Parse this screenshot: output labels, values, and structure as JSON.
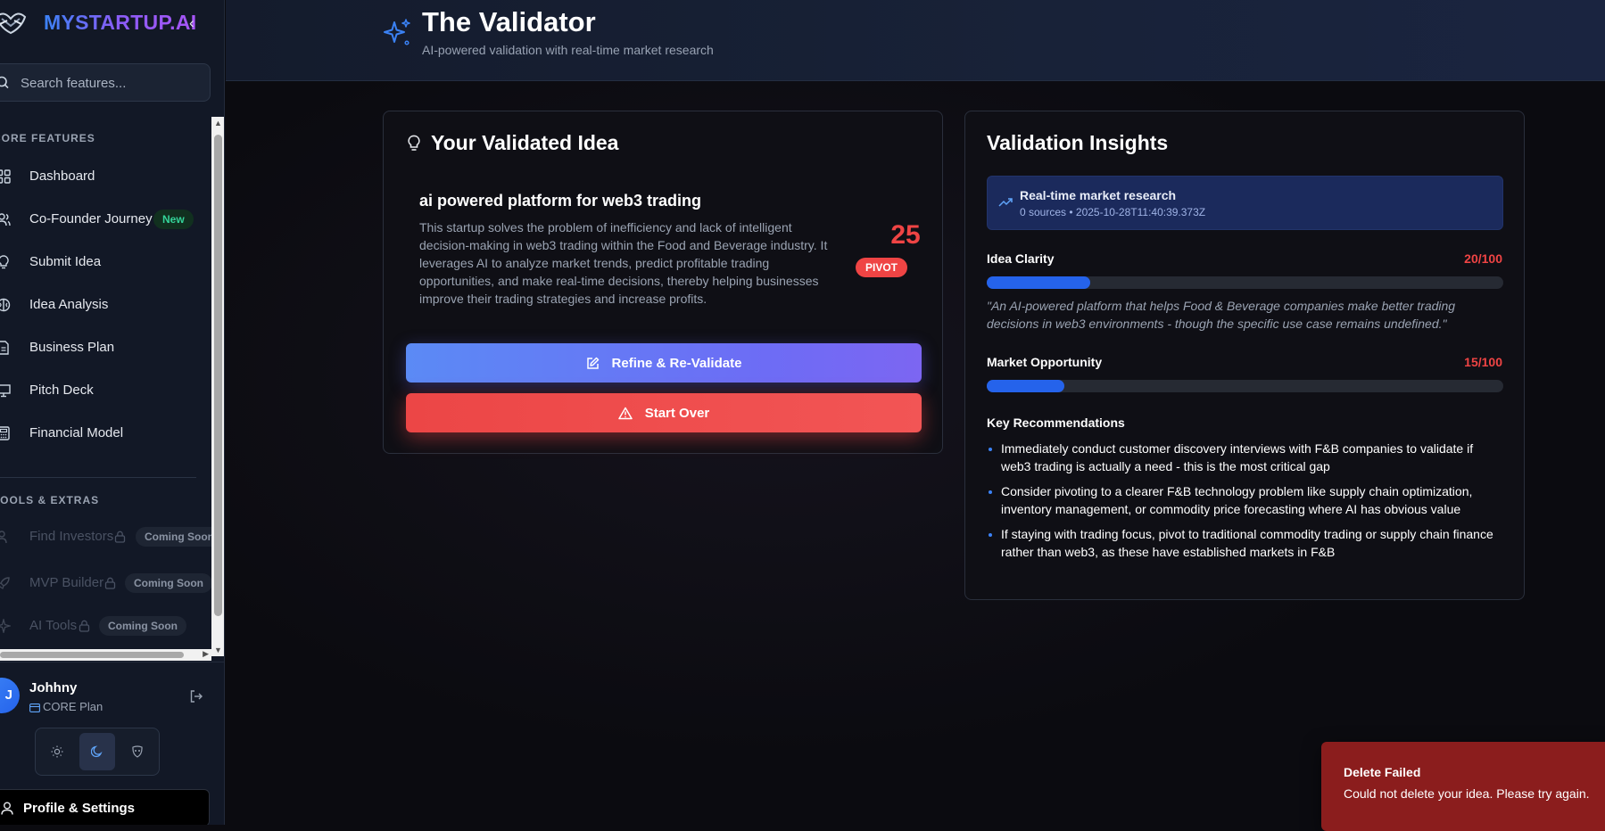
{
  "brand": {
    "name": "MYSTARTUP.AI",
    "collapse_glyph": "‹"
  },
  "search": {
    "placeholder": "Search features..."
  },
  "sidebar": {
    "sections": [
      {
        "label": "CORE FEATURES",
        "items": [
          {
            "label": "Dashboard",
            "icon": "grid-icon"
          },
          {
            "label": "Co-Founder Journey",
            "icon": "users-icon",
            "badge": "New"
          },
          {
            "label": "Submit Idea",
            "icon": "lightbulb-icon"
          },
          {
            "label": "Idea Analysis",
            "icon": "brain-icon"
          },
          {
            "label": "Business Plan",
            "icon": "document-icon"
          },
          {
            "label": "Pitch Deck",
            "icon": "presentation-icon"
          },
          {
            "label": "Financial Model",
            "icon": "calculator-icon"
          }
        ]
      },
      {
        "label": "TOOLS & EXTRAS",
        "items": [
          {
            "label": "Find Investors",
            "icon": "users-icon",
            "badge": "Coming Soon",
            "locked": true
          },
          {
            "label": "MVP Builder",
            "icon": "rocket-icon",
            "badge": "Coming Soon",
            "locked": true
          },
          {
            "label": "AI Tools",
            "icon": "sparkle-icon",
            "badge": "Coming Soon",
            "locked": true
          }
        ]
      }
    ]
  },
  "user": {
    "initial": "J",
    "name": "Johhny",
    "plan": "CORE Plan",
    "theme_options": [
      "light",
      "dark",
      "system"
    ],
    "theme_selected": "dark"
  },
  "profile_button": {
    "label": "Profile & Settings"
  },
  "header": {
    "title": "The Validator",
    "subtitle": "AI-powered validation with real-time market research"
  },
  "idea_card": {
    "title": "Your Validated Idea",
    "idea_name": "ai powered platform for web3 trading",
    "description": "This startup solves the problem of inefficiency and lack of intelligent decision-making in web3 trading within the Food and Beverage industry. It leverages AI to analyze market trends, predict profitable trading opportunities, and make real-time decisions, thereby helping businesses improve their trading strategies and increase profits.",
    "score": "25",
    "verdict": "PIVOT",
    "refine_label": "Refine & Re-Validate",
    "start_over_label": "Start Over"
  },
  "insights": {
    "title": "Validation Insights",
    "research": {
      "title": "Real-time market research",
      "meta": "0 sources • 2025-10-28T11:40:39.373Z"
    },
    "metrics": [
      {
        "label": "Idea Clarity",
        "score_text": "20/100",
        "fraction": 0.2,
        "quote": "\"An AI-powered platform that helps Food & Beverage companies make better trading decisions in web3 environments - though the specific use case remains undefined.\""
      },
      {
        "label": "Market Opportunity",
        "score_text": "15/100",
        "fraction": 0.15
      }
    ],
    "recommendations_title": "Key Recommendations",
    "recommendations": [
      "Immediately conduct customer discovery interviews with F&B companies to validate if web3 trading is actually a need - this is the most critical gap",
      "Consider pivoting to a clearer F&B technology problem like supply chain optimization, inventory management, or commodity price forecasting where AI has obvious value",
      "If staying with trading focus, pivot to traditional commodity trading or supply chain finance rather than web3, as these have established markets in F&B"
    ]
  },
  "toast": {
    "title": "Delete Failed",
    "message": "Could not delete your idea. Please try again."
  },
  "colors": {
    "accent_blue": "#2563eb",
    "danger_red": "#ef4444",
    "new_badge_green": "#34d399",
    "toast_bg": "#8b1d1d"
  }
}
